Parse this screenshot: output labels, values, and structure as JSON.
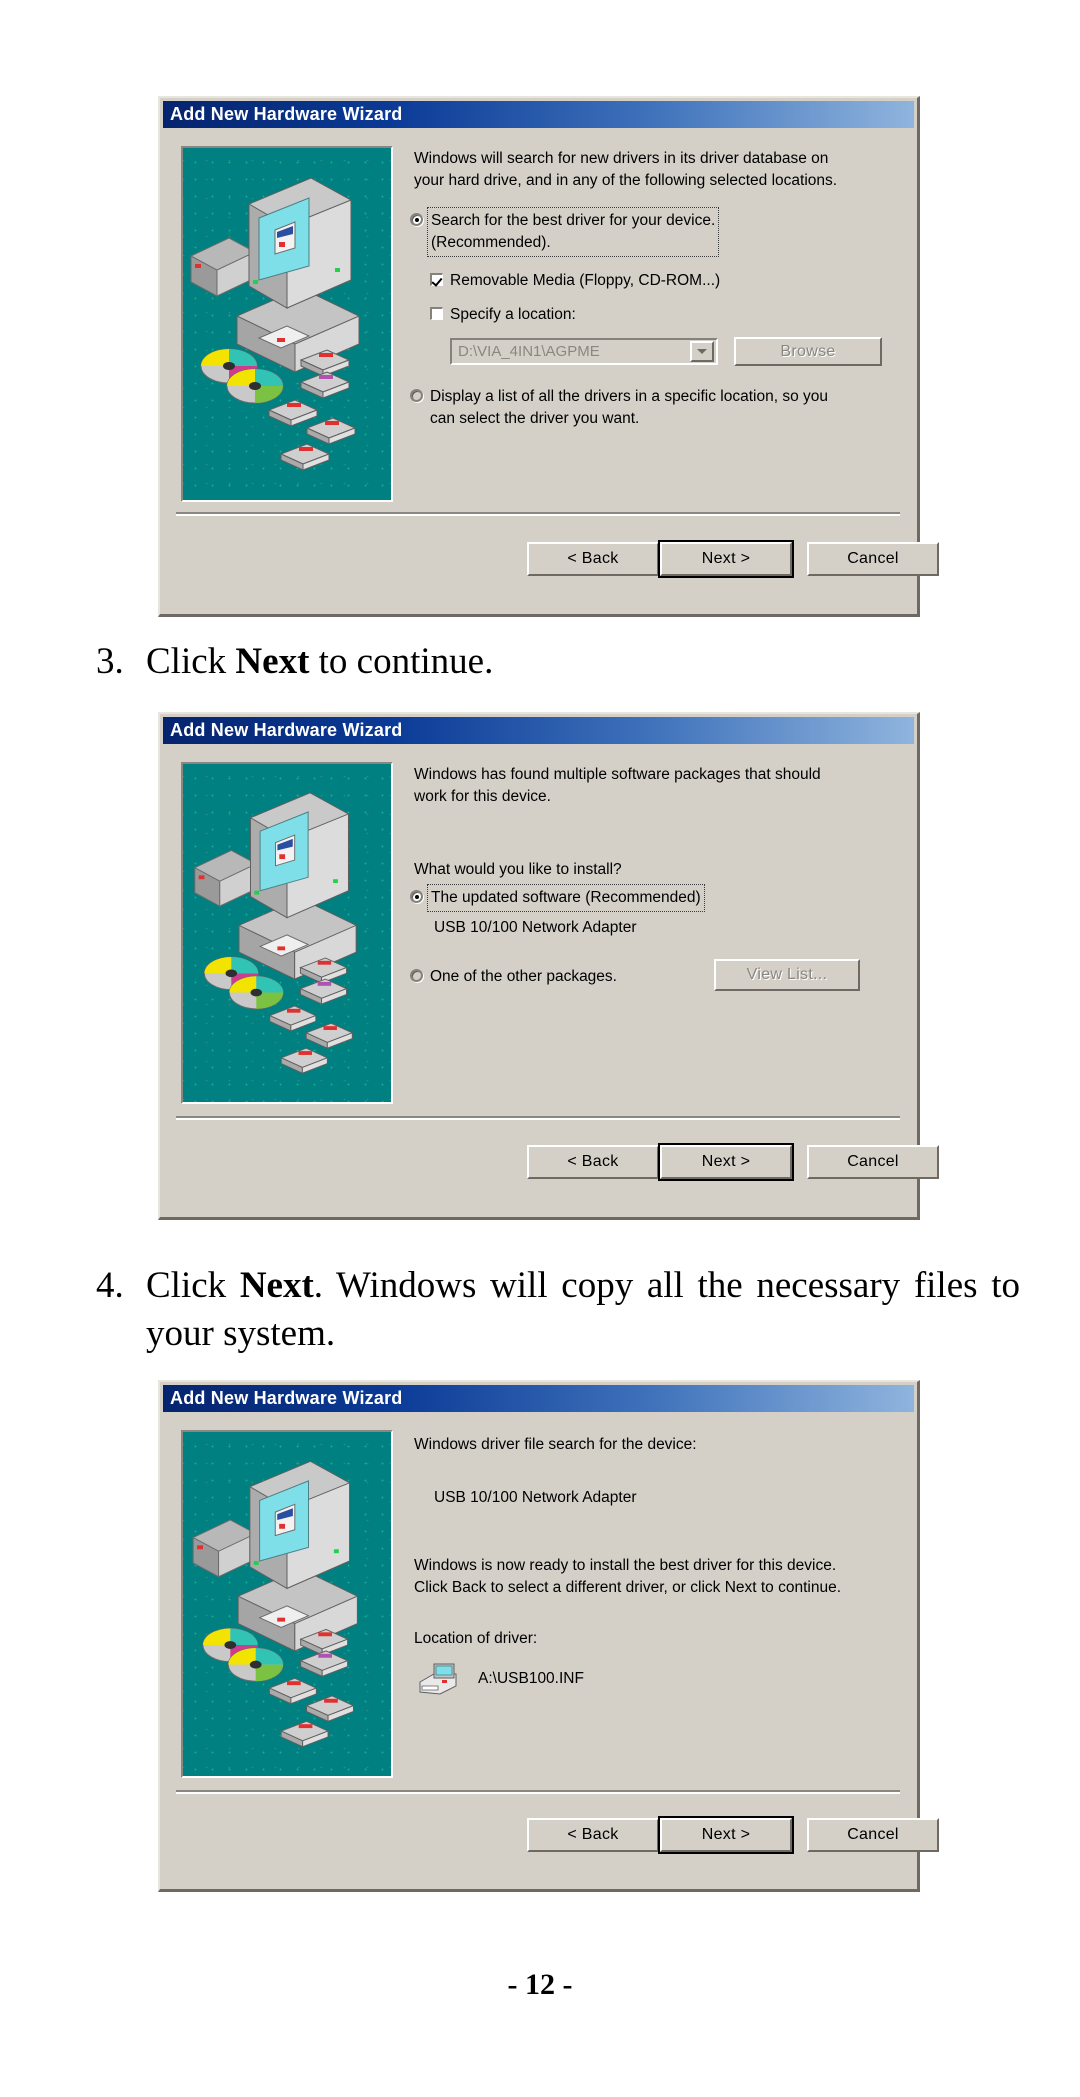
{
  "document": {
    "page_number_label": "- 12 -"
  },
  "steps": [
    {
      "number": "3.",
      "text_before": "Click ",
      "bold": "Next",
      "text_after": " to continue."
    },
    {
      "number": "4.",
      "text_before": "Click ",
      "bold": "Next",
      "text_after": ".   Windows will copy all the necessary files to your system."
    }
  ],
  "dialogs": [
    {
      "title": "Add New Hardware Wizard",
      "intro": "Windows will search for new drivers in its driver database on\nyour hard drive, and in any of the following selected locations.",
      "options": [
        {
          "type": "radio",
          "state": "checked",
          "focused": true,
          "label": "Search for the best driver for your device.\n(Recommended)."
        },
        {
          "type": "checkbox",
          "state": "checked",
          "label": "Removable Media (Floppy, CD-ROM...)",
          "accel": "M"
        },
        {
          "type": "checkbox",
          "state": "unchecked",
          "label": "Specify a location:",
          "accel": "l"
        },
        {
          "type": "radio",
          "state": "unchecked",
          "label": "Display a list of all the drivers in a specific location, so you\ncan select the driver you want.",
          "accel": "D"
        }
      ],
      "location_combo": {
        "value": "D:\\VIA_4IN1\\AGPME",
        "placeholder": "D:\\VIA_4IN1\\AGPME",
        "disabled": true
      },
      "browse_button": {
        "label": "Browse",
        "accel": "r",
        "disabled": true
      },
      "buttons": [
        {
          "label": "< Back",
          "accel": "B",
          "default": false
        },
        {
          "label": "Next >",
          "default": true
        },
        {
          "label": "Cancel",
          "default": false
        }
      ]
    },
    {
      "title": "Add New Hardware Wizard",
      "intro": "Windows has found multiple software packages that should\nwork for this device.",
      "question": "What would you like to install?",
      "options": [
        {
          "type": "radio",
          "state": "checked",
          "focused": true,
          "label": "The updated software (Recommended)",
          "accel": "T"
        },
        {
          "type": "radio",
          "state": "unchecked",
          "label": "One of the other packages.",
          "accel": "O"
        }
      ],
      "device_name": "USB 10/100 Network Adapter",
      "view_list_button": {
        "label": "View List...",
        "accel": "V",
        "disabled": true
      },
      "buttons": [
        {
          "label": "< Back",
          "accel": "B",
          "default": false
        },
        {
          "label": "Next >",
          "default": true
        },
        {
          "label": "Cancel",
          "default": false
        }
      ]
    },
    {
      "title": "Add New Hardware Wizard",
      "intro": "Windows driver file search for the device:",
      "device_name": "USB 10/100 Network Adapter",
      "ready_text": "Windows is now ready to install the best driver for this device.\nClick Back to select a different driver, or click Next to continue.",
      "location_label": "Location of driver:",
      "driver_path": "A:\\USB100.INF",
      "buttons": [
        {
          "label": "< Back",
          "accel": "B",
          "default": false
        },
        {
          "label": "Next >",
          "default": true
        },
        {
          "label": "Cancel",
          "default": false
        }
      ]
    }
  ],
  "colors": {
    "titlebar_start": "#06246e",
    "titlebar_end": "#8fb4dd",
    "dialog_face": "#d4d0c8",
    "art_panel": "#008080",
    "disabled_text": "#8a8781"
  },
  "icons": {
    "computer_art": "computer-and-drivers-illustration",
    "driver_file": "floppy-drive-icon",
    "combo_arrow": "chevron-down-icon"
  }
}
